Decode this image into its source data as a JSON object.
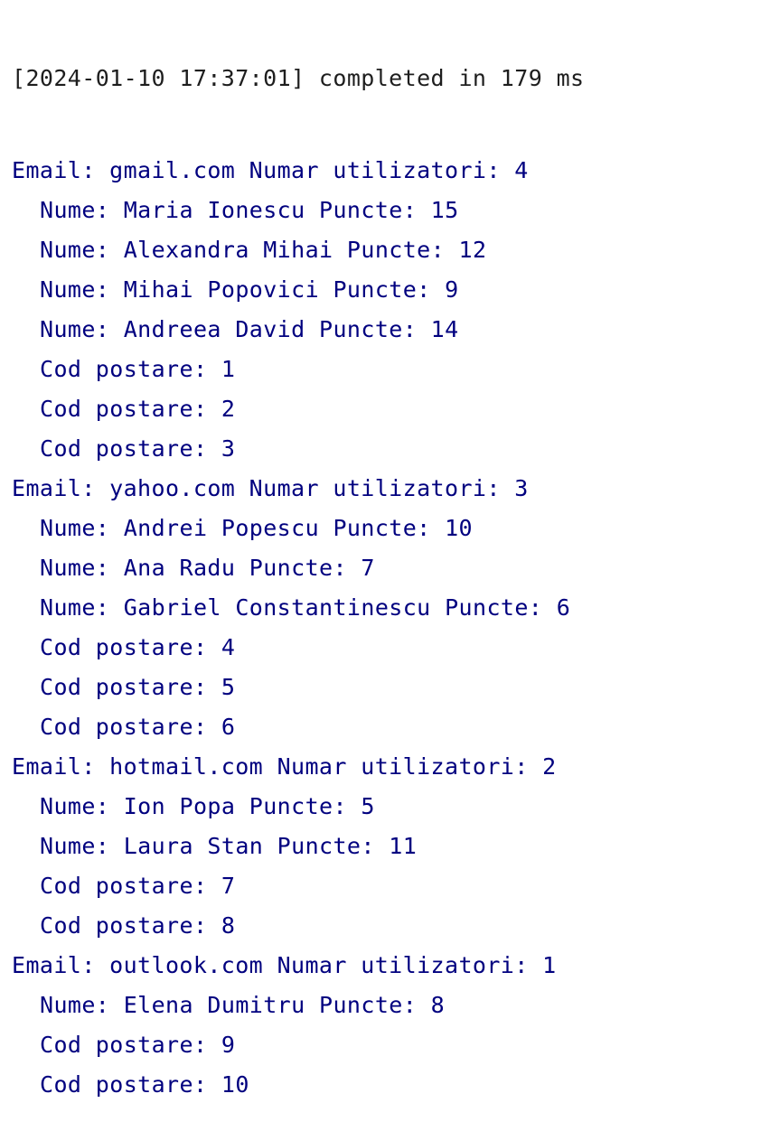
{
  "console": {
    "header": "[2024-01-10 17:37:01] completed in 179 ms",
    "colors": {
      "header_text": "#1e1e1e",
      "output_text": "#00007f",
      "background": "#ffffff"
    },
    "lines": [
      {
        "text": "Email: gmail.com Numar utilizatori: 4",
        "indent": false
      },
      {
        "text": "Nume: Maria Ionescu Puncte: 15",
        "indent": true
      },
      {
        "text": "Nume: Alexandra Mihai Puncte: 12",
        "indent": true
      },
      {
        "text": "Nume: Mihai Popovici Puncte: 9",
        "indent": true
      },
      {
        "text": "Nume: Andreea David Puncte: 14",
        "indent": true
      },
      {
        "text": "Cod postare: 1",
        "indent": true
      },
      {
        "text": "Cod postare: 2",
        "indent": true
      },
      {
        "text": "Cod postare: 3",
        "indent": true
      },
      {
        "text": "Email: yahoo.com Numar utilizatori: 3",
        "indent": false
      },
      {
        "text": "Nume: Andrei Popescu Puncte: 10",
        "indent": true
      },
      {
        "text": "Nume: Ana Radu Puncte: 7",
        "indent": true
      },
      {
        "text": "Nume: Gabriel Constantinescu Puncte: 6",
        "indent": true
      },
      {
        "text": "Cod postare: 4",
        "indent": true
      },
      {
        "text": "Cod postare: 5",
        "indent": true
      },
      {
        "text": "Cod postare: 6",
        "indent": true
      },
      {
        "text": "Email: hotmail.com Numar utilizatori: 2",
        "indent": false
      },
      {
        "text": "Nume: Ion Popa Puncte: 5",
        "indent": true
      },
      {
        "text": "Nume: Laura Stan Puncte: 11",
        "indent": true
      },
      {
        "text": "Cod postare: 7",
        "indent": true
      },
      {
        "text": "Cod postare: 8",
        "indent": true
      },
      {
        "text": "Email: outlook.com Numar utilizatori: 1",
        "indent": false
      },
      {
        "text": "Nume: Elena Dumitru Puncte: 8",
        "indent": true
      },
      {
        "text": "Cod postare: 9",
        "indent": true
      },
      {
        "text": "Cod postare: 10",
        "indent": true
      }
    ]
  }
}
